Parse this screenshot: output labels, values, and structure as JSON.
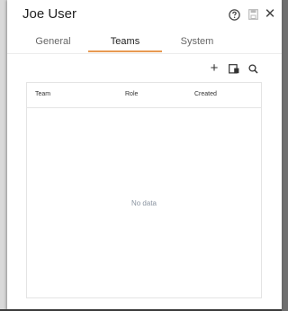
{
  "dialog": {
    "title": "Joe User",
    "icons": {
      "help": "question-circle-icon",
      "save": "save-icon",
      "close": "close-icon",
      "close_glyph": "✕"
    }
  },
  "tabs": [
    {
      "label": "General",
      "active": false
    },
    {
      "label": "Teams",
      "active": true
    },
    {
      "label": "System",
      "active": false
    }
  ],
  "toolbar": {
    "add_glyph": "+",
    "icons": [
      "add-icon",
      "export-icon",
      "search-icon"
    ]
  },
  "table": {
    "columns": [
      "Team",
      "Role",
      "Created"
    ],
    "empty_text": "No data"
  },
  "colors": {
    "accent": "#e89a52",
    "empty_text": "#8b95a1"
  }
}
